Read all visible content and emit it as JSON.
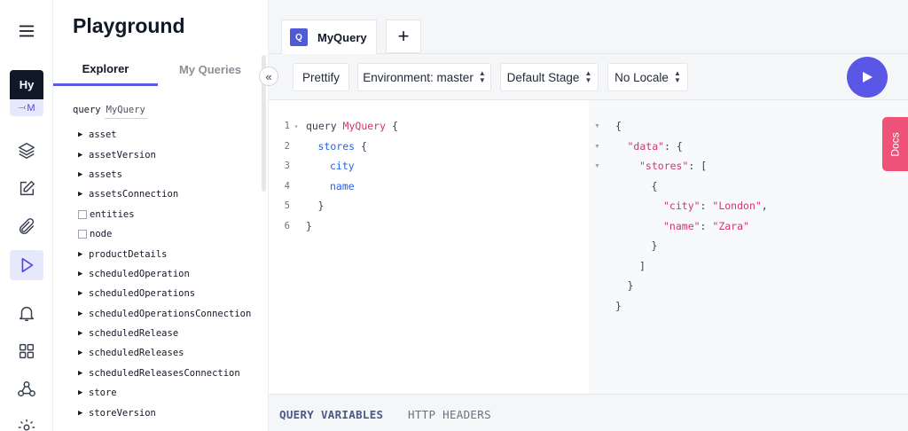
{
  "explorer": {
    "title": "Playground",
    "tabs": [
      "Explorer",
      "My Queries"
    ],
    "query_keyword": "query",
    "query_name": "MyQuery",
    "collapse_label": "«",
    "items": [
      {
        "label": "asset",
        "kind": "arrow"
      },
      {
        "label": "assetVersion",
        "kind": "arrow"
      },
      {
        "label": "assets",
        "kind": "arrow"
      },
      {
        "label": "assetsConnection",
        "kind": "arrow"
      },
      {
        "label": "entities",
        "kind": "checkbox"
      },
      {
        "label": "node",
        "kind": "checkbox"
      },
      {
        "label": "productDetails",
        "kind": "arrow"
      },
      {
        "label": "scheduledOperation",
        "kind": "arrow"
      },
      {
        "label": "scheduledOperations",
        "kind": "arrow"
      },
      {
        "label": "scheduledOperationsConnection",
        "kind": "arrow"
      },
      {
        "label": "scheduledRelease",
        "kind": "arrow"
      },
      {
        "label": "scheduledReleases",
        "kind": "arrow"
      },
      {
        "label": "scheduledReleasesConnection",
        "kind": "arrow"
      },
      {
        "label": "store",
        "kind": "arrow"
      },
      {
        "label": "storeVersion",
        "kind": "arrow"
      }
    ]
  },
  "rail": {
    "project_abbr": "Hy",
    "env_label": "M",
    "icons": [
      "menu-icon",
      "layers-icon",
      "edit-icon",
      "attachment-icon",
      "play-icon",
      "bell-icon",
      "grid-icon",
      "webhook-icon",
      "settings-icon"
    ]
  },
  "tabbar": {
    "query_badge": "Q",
    "query_tab": "MyQuery",
    "add_label": "+"
  },
  "toolbar": {
    "prettify": "Prettify",
    "environment": "Environment: master",
    "stage": "Default Stage",
    "locale": "No Locale"
  },
  "editor": {
    "lines": [
      {
        "n": "1",
        "fold": "▾",
        "indent": 0,
        "kw": "query ",
        "name": "MyQuery",
        "rest": " {"
      },
      {
        "n": "2",
        "fold": "",
        "indent": 1,
        "field": "stores",
        "rest": " {"
      },
      {
        "n": "3",
        "fold": "",
        "indent": 2,
        "field": "city",
        "rest": ""
      },
      {
        "n": "4",
        "fold": "",
        "indent": 2,
        "field": "name",
        "rest": ""
      },
      {
        "n": "5",
        "fold": "",
        "indent": 1,
        "rest": "}"
      },
      {
        "n": "6",
        "fold": "",
        "indent": 0,
        "rest": "}"
      }
    ]
  },
  "result": {
    "lines": [
      {
        "fold": true,
        "indent": 0,
        "parts": [
          [
            "p",
            "{"
          ]
        ]
      },
      {
        "fold": true,
        "indent": 1,
        "parts": [
          [
            "k",
            "\"data\""
          ],
          [
            "p",
            ": {"
          ]
        ]
      },
      {
        "fold": true,
        "indent": 2,
        "parts": [
          [
            "k",
            "\"stores\""
          ],
          [
            "p",
            ": ["
          ]
        ]
      },
      {
        "fold": false,
        "indent": 3,
        "parts": [
          [
            "p",
            "{"
          ]
        ]
      },
      {
        "fold": false,
        "indent": 4,
        "parts": [
          [
            "k",
            "\"city\""
          ],
          [
            "p",
            ": "
          ],
          [
            "v",
            "\"London\""
          ],
          [
            "p",
            ","
          ]
        ]
      },
      {
        "fold": false,
        "indent": 4,
        "parts": [
          [
            "k",
            "\"name\""
          ],
          [
            "p",
            ": "
          ],
          [
            "v",
            "\"Zara\""
          ]
        ]
      },
      {
        "fold": false,
        "indent": 3,
        "parts": [
          [
            "p",
            "}"
          ]
        ]
      },
      {
        "fold": false,
        "indent": 2,
        "parts": [
          [
            "p",
            "]"
          ]
        ]
      },
      {
        "fold": false,
        "indent": 1,
        "parts": [
          [
            "p",
            "}"
          ]
        ]
      },
      {
        "fold": false,
        "indent": 0,
        "parts": [
          [
            "p",
            "}"
          ]
        ]
      }
    ]
  },
  "docs_label": "Docs",
  "bottom_tabs": [
    "QUERY VARIABLES",
    "HTTP HEADERS"
  ],
  "colors": {
    "accent": "#5a57e6",
    "docs": "#ef5279",
    "string": "#d6336c",
    "field": "#2563eb"
  }
}
